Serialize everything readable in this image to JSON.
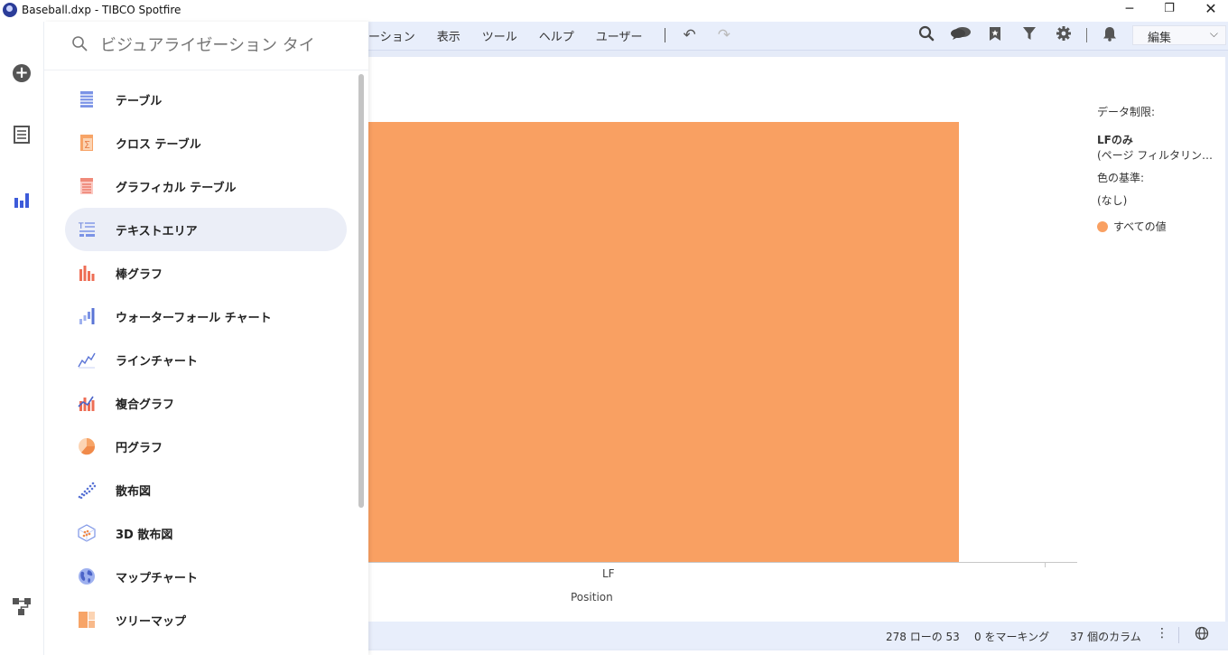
{
  "window": {
    "title": "Baseball.dxp - TIBCO Spotfire",
    "minimize_glyph": "─",
    "restore_glyph": "❐",
    "close_glyph": "✕"
  },
  "menu": {
    "items": [
      "ーション",
      "表示",
      "ツール",
      "ヘルプ",
      "ユーザー"
    ],
    "undo_icon": "undo-icon",
    "redo_icon": "redo-icon",
    "mode_select_value": "編集"
  },
  "right_toolbar": {
    "icons": [
      "search-icon",
      "comments-icon",
      "bookmark-icon",
      "filter-icon",
      "settings-icon",
      "notifications-icon"
    ]
  },
  "rail": {
    "items": [
      "add-icon",
      "data-table-icon",
      "visualizations-icon",
      "data-canvas-icon"
    ]
  },
  "search": {
    "placeholder": "ビジュアライゼーション タイ"
  },
  "visualizations": [
    {
      "label": "テーブル",
      "icon": "table-icon",
      "selected": false
    },
    {
      "label": "クロス テーブル",
      "icon": "cross-table-icon",
      "selected": false
    },
    {
      "label": "グラフィカル テーブル",
      "icon": "graphical-table-icon",
      "selected": false
    },
    {
      "label": "テキストエリア",
      "icon": "text-area-icon",
      "selected": true
    },
    {
      "label": "棒グラフ",
      "icon": "bar-chart-icon",
      "selected": false
    },
    {
      "label": "ウォーターフォール チャート",
      "icon": "waterfall-chart-icon",
      "selected": false
    },
    {
      "label": "ラインチャート",
      "icon": "line-chart-icon",
      "selected": false
    },
    {
      "label": "複合グラフ",
      "icon": "combination-chart-icon",
      "selected": false
    },
    {
      "label": "円グラフ",
      "icon": "pie-chart-icon",
      "selected": false
    },
    {
      "label": "散布図",
      "icon": "scatter-plot-icon",
      "selected": false
    },
    {
      "label": "3D 散布図",
      "icon": "3d-scatter-plot-icon",
      "selected": false
    },
    {
      "label": "マップチャート",
      "icon": "map-chart-icon",
      "selected": false
    },
    {
      "label": "ツリーマップ",
      "icon": "treemap-icon",
      "selected": false
    }
  ],
  "chart_data": {
    "type": "bar",
    "categories": [
      "LF"
    ],
    "xlabel": "Position",
    "colors": {
      "bar": "#f9a062"
    }
  },
  "legend": {
    "limit_title": "データ制限:",
    "limit_value": "LFのみ",
    "limit_note": "(ページ フィルタリングは...",
    "colorby_title": "色の基準:",
    "colorby_value": "(なし)",
    "item_label": "すべての値"
  },
  "status": {
    "rows": "278 ローの 53",
    "marked": "0 をマーキング",
    "columns": "37 個のカラム"
  }
}
